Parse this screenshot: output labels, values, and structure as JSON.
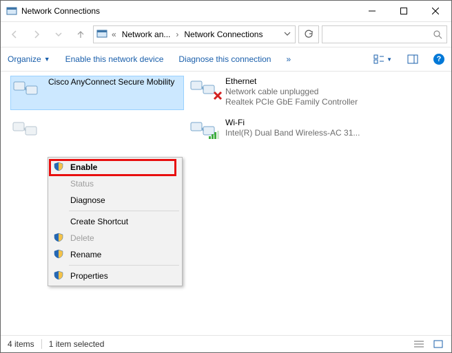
{
  "window": {
    "title": "Network Connections"
  },
  "nav": {
    "crumb1": "Network an...",
    "crumb2": "Network Connections"
  },
  "cmdbar": {
    "organize": "Organize",
    "enable": "Enable this network device",
    "diagnose": "Diagnose this connection",
    "more": "»"
  },
  "items": {
    "cisco": {
      "name": "Cisco AnyConnect Secure Mobility"
    },
    "ethernet": {
      "name": "Ethernet",
      "status": "Network cable unplugged",
      "adapter": "Realtek PCIe GbE Family Controller"
    },
    "wifi": {
      "name": "Wi-Fi",
      "status": "",
      "adapter": "Intel(R) Dual Band Wireless-AC 31..."
    }
  },
  "context_menu": {
    "enable": "Enable",
    "status": "Status",
    "diagnose": "Diagnose",
    "create_shortcut": "Create Shortcut",
    "delete": "Delete",
    "rename": "Rename",
    "properties": "Properties"
  },
  "status": {
    "count": "4 items",
    "selected": "1 item selected"
  }
}
